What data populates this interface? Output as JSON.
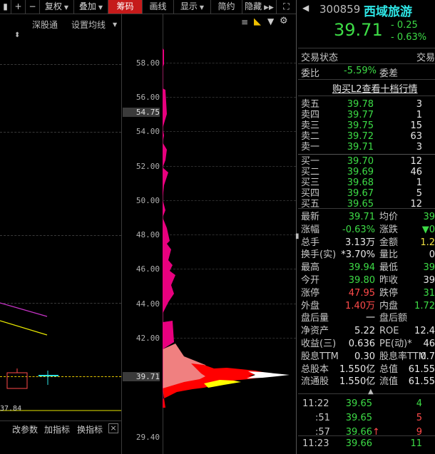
{
  "toolbar": {
    "buttons": [
      "复权",
      "叠加",
      "筹码",
      "画线",
      "显示",
      "简约",
      "隐藏"
    ],
    "active": "筹码"
  },
  "left": {
    "sub1": "深股通",
    "sub2": "设置均线",
    "price_low": "37.84",
    "bottom_buttons": [
      "改参数",
      "加指标",
      "换指标"
    ]
  },
  "chips": {
    "price_ticks": [
      "58.00",
      "56.00",
      "54.75",
      "54.00",
      "52.00",
      "50.00",
      "48.00",
      "46.00",
      "44.00",
      "42.00",
      "39.71",
      "29.40"
    ],
    "current_price_label": "39.71",
    "high_label": "54.75"
  },
  "stock": {
    "code": "300859",
    "name": "西域旅游",
    "price": "39.71",
    "change": "- 0.25",
    "change_pct": "- 0.63%",
    "trade_status_label": "交易状态",
    "trade_status_value": "交易",
    "weibi_label": "委比",
    "weibi_value": "-5.59%",
    "weicha_label": "委差",
    "l2_link": "购买L2查看十档行情"
  },
  "sell": [
    {
      "label": "卖五",
      "price": "39.78",
      "vol": "3"
    },
    {
      "label": "卖四",
      "price": "39.77",
      "vol": "1"
    },
    {
      "label": "卖三",
      "price": "39.75",
      "vol": "15"
    },
    {
      "label": "卖二",
      "price": "39.72",
      "vol": "63"
    },
    {
      "label": "卖一",
      "price": "39.71",
      "vol": "3"
    }
  ],
  "buy": [
    {
      "label": "买一",
      "price": "39.70",
      "vol": "12"
    },
    {
      "label": "买二",
      "price": "39.69",
      "vol": "46"
    },
    {
      "label": "买三",
      "price": "39.68",
      "vol": "1"
    },
    {
      "label": "买四",
      "price": "39.67",
      "vol": "5"
    },
    {
      "label": "买五",
      "price": "39.65",
      "vol": "12"
    }
  ],
  "stats": [
    {
      "l1": "最新",
      "v1": "39.71",
      "c1": "g",
      "l2": "均价",
      "v2": "39",
      "c2": "g"
    },
    {
      "l1": "涨幅",
      "v1": "-0.63%",
      "c1": "g",
      "l2": "涨跌",
      "v2": "▼0",
      "c2": "g"
    },
    {
      "l1": "总手",
      "v1": "3.13万",
      "c1": "w",
      "l2": "金额",
      "v2": "1.2",
      "c2": "y"
    },
    {
      "l1": "换手(实)",
      "v1": "*3.70%",
      "c1": "w",
      "l2": "量比",
      "v2": "0",
      "c2": "w"
    },
    {
      "l1": "最高",
      "v1": "39.94",
      "c1": "g",
      "l2": "最低",
      "v2": "39",
      "c2": "g"
    },
    {
      "l1": "今开",
      "v1": "39.80",
      "c1": "g",
      "l2": "昨收",
      "v2": "39",
      "c2": "w"
    },
    {
      "l1": "涨停",
      "v1": "47.95",
      "c1": "r",
      "l2": "跌停",
      "v2": "31",
      "c2": "g"
    },
    {
      "l1": "外盘",
      "v1": "1.40万",
      "c1": "r",
      "l2": "内盘",
      "v2": "1.72",
      "c2": "g"
    },
    {
      "l1": "盘后量",
      "v1": "一",
      "c1": "w",
      "l2": "盘后额",
      "v2": "",
      "c2": "w"
    },
    {
      "l1": "净资产",
      "v1": "5.22",
      "c1": "w",
      "l2": "ROE",
      "v2": "12.4",
      "c2": "w"
    },
    {
      "l1": "收益(三)",
      "v1": "0.636",
      "c1": "w",
      "l2": "PE(动)*",
      "v2": "46",
      "c2": "w"
    },
    {
      "l1": "股息TTM",
      "v1": "0.30",
      "c1": "w",
      "l2": "股息率TTM",
      "v2": "0.7",
      "c2": "w"
    },
    {
      "l1": "总股本",
      "v1": "1.550亿",
      "c1": "w",
      "l2": "总值",
      "v2": "61.55",
      "c2": "w"
    },
    {
      "l1": "流通股",
      "v1": "1.550亿",
      "c1": "w",
      "l2": "流值",
      "v2": "61.55",
      "c2": "w"
    }
  ],
  "ticks": [
    {
      "time": "11:22",
      "price": "39.65",
      "vol": "4",
      "vcol": "g",
      "arrow": ""
    },
    {
      "time": ":51",
      "price": "39.65",
      "vol": "5",
      "vcol": "r",
      "arrow": ""
    },
    {
      "time": ":57",
      "price": "39.66",
      "vol": "9",
      "vcol": "r",
      "arrow": "↑"
    },
    {
      "time": "11:23",
      "price": "39.66",
      "vol": "11",
      "vcol": "g",
      "arrow": ""
    }
  ],
  "colors": {
    "up": "#ff4a4a",
    "down": "#3ddc46",
    "active": "#c51a1a",
    "chip_magenta": "#e8007e",
    "chip_red": "#ff0000",
    "chip_yellow": "#ffff00",
    "chip_pink": "#f08080"
  }
}
